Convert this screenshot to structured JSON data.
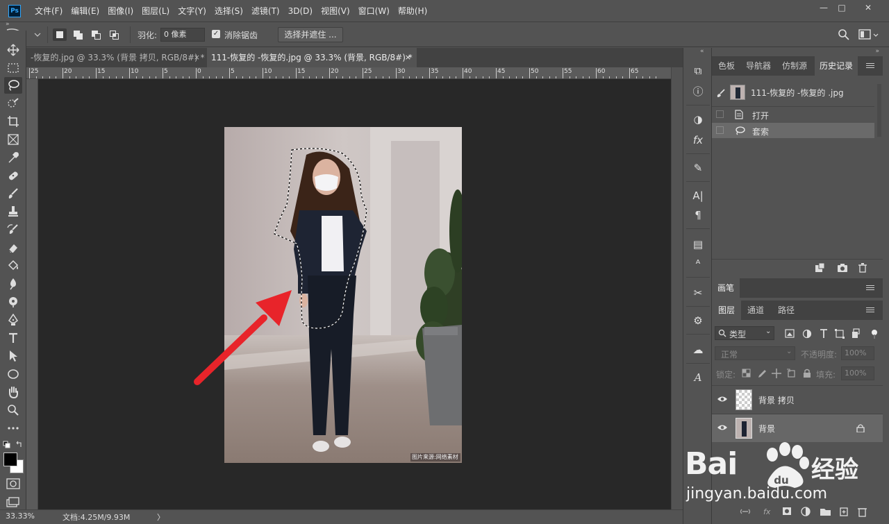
{
  "app": {
    "logo": "Ps",
    "menus": [
      "文件(F)",
      "编辑(E)",
      "图像(I)",
      "图层(L)",
      "文字(Y)",
      "选择(S)",
      "滤镜(T)",
      "3D(D)",
      "视图(V)",
      "窗口(W)",
      "帮助(H)"
    ],
    "window_controls": [
      "—",
      "□",
      "✕"
    ]
  },
  "options": {
    "feather_label": "羽化:",
    "feather_value": "0 像素",
    "antialias_label": "消除锯齿",
    "select_mask_button": "选择并遮住 ..."
  },
  "tabs": [
    {
      "label": "-恢复的.jpg @ 33.3% (背景 拷贝, RGB/8#) *",
      "close": "×",
      "active": false
    },
    {
      "label": "111-恢复的 -恢复的.jpg @ 33.3% (背景, RGB/8#) *",
      "close": "×",
      "active": true
    }
  ],
  "ruler_h_labels": [
    "25",
    "20",
    "15",
    "10",
    "5",
    "0",
    "5",
    "10",
    "15",
    "20",
    "25",
    "30",
    "35",
    "40",
    "45",
    "50",
    "55",
    "60",
    "65"
  ],
  "photo_caption": "图片来源:网络素材",
  "status": {
    "zoom": "33.33%",
    "doc_info": "文档:4.25M/9.93M",
    "arrow": "〉"
  },
  "panels": {
    "top_tabs": [
      "色板",
      "导航器",
      "仿制源",
      "历史记录"
    ],
    "history_snapshot": "111-恢复的 -恢复的 .jpg",
    "history_items": [
      "打开",
      "套索"
    ],
    "brush_tab": "画笔",
    "layer_tabs": [
      "图层",
      "通道",
      "路径"
    ],
    "filter_kind": "类型",
    "blend_mode": "正常",
    "opacity_label": "不透明度:",
    "opacity_value": "100%",
    "lock_label": "锁定:",
    "fill_label": "填充:",
    "fill_value": "100%",
    "layers": [
      {
        "name": "背景 拷贝"
      },
      {
        "name": "背景"
      }
    ]
  },
  "watermark": {
    "brand_left": "Bai",
    "brand_right": "经验",
    "url": "jingyan.baidu.com"
  },
  "colors": {
    "ui_bg": "#535353",
    "pasteboard": "#282828",
    "arrow": "#e8242a",
    "ps_blue": "#31a8ff"
  }
}
